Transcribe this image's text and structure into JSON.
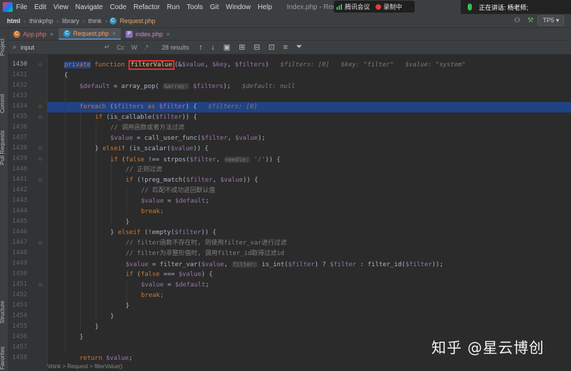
{
  "menubar": {
    "items": [
      "File",
      "Edit",
      "View",
      "Navigate",
      "Code",
      "Refactor",
      "Run",
      "Tools",
      "Git",
      "Window",
      "Help"
    ],
    "title": "Index.php - Request.php"
  },
  "meeting": {
    "name": "腾讯会议",
    "recording": "录制中"
  },
  "speaking": {
    "text": "正在讲话: 杨老师;"
  },
  "breadcrumb": {
    "items": [
      "html",
      "thinkphp",
      "library",
      "think"
    ],
    "file": "Request.php"
  },
  "toolbar_right": {
    "run_config": "TP5"
  },
  "tabs": [
    {
      "label": "App.php"
    },
    {
      "label": "Request.php"
    },
    {
      "label": "index.php"
    }
  ],
  "search": {
    "value": "input",
    "case_label": "Cc",
    "word_label": "W",
    "regex_label": ".*",
    "results": "28 results"
  },
  "sidebar_labels": {
    "project": "Project",
    "commit": "Commit",
    "pull_requests": "Pull Requests",
    "structure": "Structure",
    "favorites": "Favorites"
  },
  "gutter": {
    "line_numbers": [
      "1430",
      "1431",
      "1432",
      "1433",
      "1434",
      "1435",
      "1436",
      "1437",
      "1438",
      "1439",
      "1440",
      "1441",
      "1442",
      "1443",
      "1444",
      "1445",
      "1446",
      "1447",
      "1448",
      "1449",
      "1450",
      "1451",
      "1452",
      "1453",
      "1454",
      "1455",
      "1456",
      "1457",
      "1458"
    ]
  },
  "code": {
    "l1430": {
      "kw_private": "private",
      "kw_function": "function",
      "fn_name": "filterValue",
      "params_open": "(&",
      "p1": "$value",
      "comma1": ", ",
      "p2": "$key",
      "comma2": ", ",
      "p3": "$filters",
      "close": ")",
      "hint1": "$filters: [0]",
      "hint2": "$key: \"filter\"",
      "hint3": "$value: \"system\""
    },
    "l1431": "{",
    "l1432": {
      "var": "$default",
      "eq": " = array_pop( ",
      "hint": "&array:",
      "arg": " $filters",
      "end": ");",
      "inlay": "$default: null"
    },
    "l1434": {
      "kw": "foreach",
      "open": " (",
      "v1": "$filters",
      "as": " as ",
      "v2": "$filter",
      "end": ") {",
      "inlay": "$filters: [0]"
    },
    "l1435": {
      "kw": "if",
      "a": " (is_callable(",
      "v": "$filter",
      "b": ")) {"
    },
    "l1436": "// 调用函数或者方法过滤",
    "l1437": {
      "v1": "$value",
      "a": " = call_user_func(",
      "v2": "$filter",
      "b": ", ",
      "v3": "$value",
      "c": ");"
    },
    "l1438": {
      "a": "} ",
      "kw": "elseif",
      "b": " (is_scalar(",
      "v": "$value",
      "c": ")) {"
    },
    "l1439": {
      "kw1": "if",
      "a": " (",
      "kw2": "false",
      "b": " !== strpos(",
      "v": "$filter",
      "c": ", ",
      "hint": "needle:",
      "str": " '/'",
      "d": ")) {"
    },
    "l1440": "// 正则过滤",
    "l1441": {
      "kw": "if",
      "a": " (!preg_match(",
      "v1": "$filter",
      "b": ", ",
      "v2": "$value",
      "c": ")) {"
    },
    "l1442": "// 匹配不成功返回默认值",
    "l1443": {
      "v1": "$value",
      "a": " = ",
      "v2": "$default",
      "b": ";"
    },
    "l1444": "break;",
    "l1445": "}",
    "l1446": {
      "a": "} ",
      "kw": "elseif",
      "b": " (!empty(",
      "v": "$filter",
      "c": ")) {"
    },
    "l1447": "// filter函数不存在时, 则使用filter_var进行过滤",
    "l1448": "// filter为非整形值时, 调用filter_id取得过滤id",
    "l1449": {
      "v1": "$value",
      "a": " = filter_var(",
      "v2": "$value",
      "b": ", ",
      "hint": "filter:",
      "c": " is_int(",
      "v3": "$filter",
      "d": ") ? ",
      "v4": "$filter",
      "e": " : filter_id(",
      "v5": "$filter",
      "f": "));"
    },
    "l1450": {
      "kw1": "if",
      "a": " (",
      "kw2": "false",
      "b": " === ",
      "v": "$value",
      "c": ") {"
    },
    "l1451": {
      "v1": "$value",
      "a": " = ",
      "v2": "$default",
      "b": ";"
    },
    "l1452": "break;",
    "l1453": "}",
    "l1454": "}",
    "l1455": "}",
    "l1456": "}",
    "l1458": {
      "kw": "return",
      "v": " $value",
      "end": ";"
    }
  },
  "status_crumb": "\\think  >  Request  >  filterValue()",
  "watermark": "知乎 @星云博创",
  "colors": {
    "keyword": "#cc7832",
    "variable": "#9876aa",
    "function": "#ffc66d",
    "string": "#6a8759",
    "comment": "#808080",
    "highlight_row": "#214283",
    "red_box": "#e03030"
  }
}
